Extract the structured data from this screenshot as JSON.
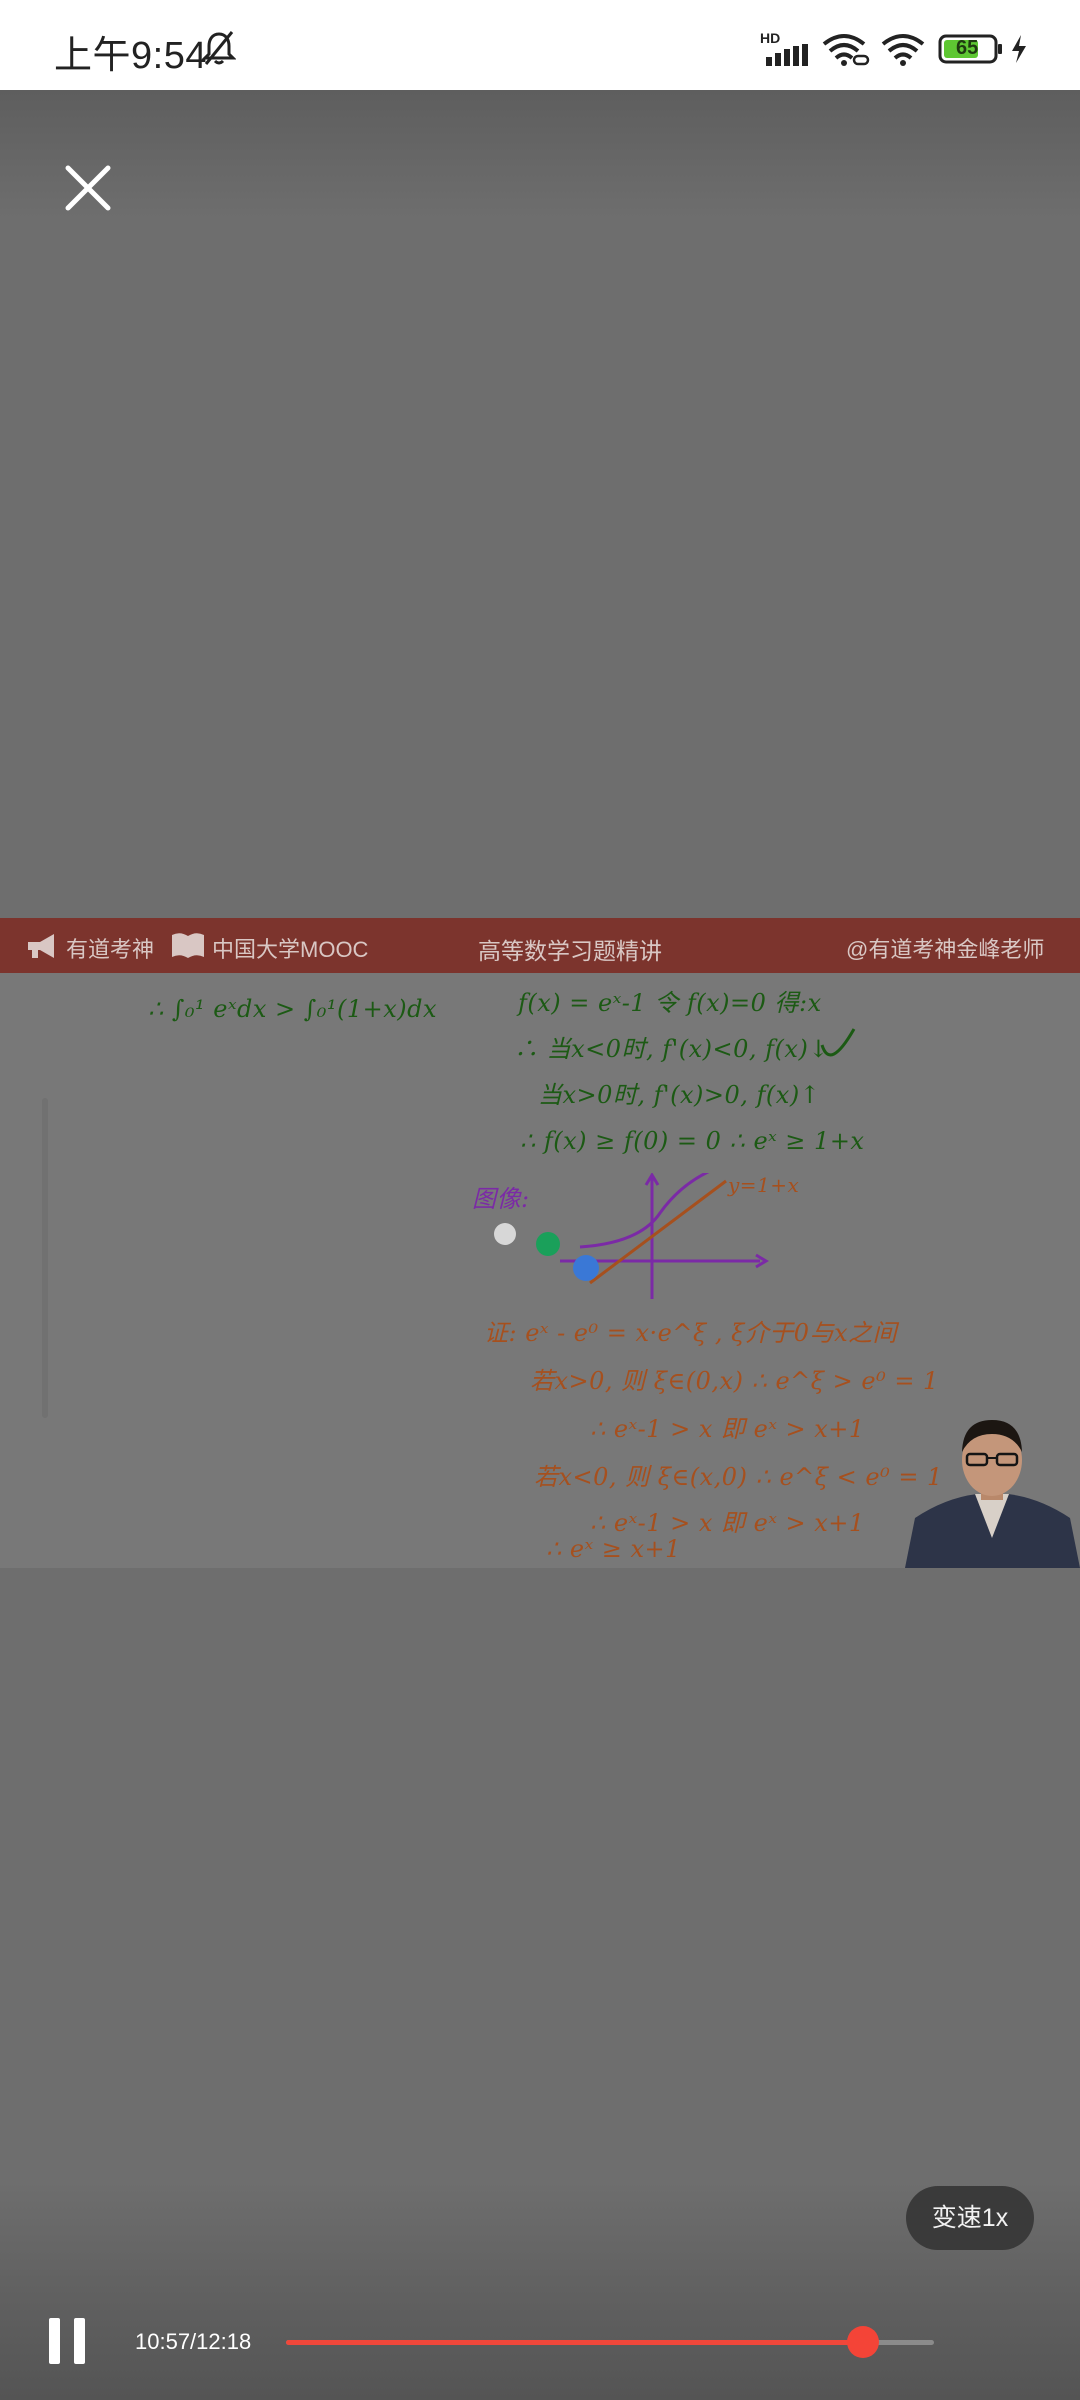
{
  "status_bar": {
    "time": "上午9:54",
    "battery_percent": "65",
    "signal_badge": "HD",
    "icons": [
      "bell-off-icon",
      "cellular-signal-icon",
      "wifi-link-icon",
      "wifi-icon",
      "battery-icon",
      "charging-icon"
    ]
  },
  "player": {
    "close_icon": "close-icon",
    "video": {
      "banner": {
        "brand_1": "有道考神",
        "brand_2": "中国大学MOOC",
        "course_title": "高等数学习题精讲",
        "teacher_handle": "@有道考神金峰老师"
      },
      "board": {
        "left_line": "∴ ∫₀¹ eˣdx > ∫₀¹(1+x)dx",
        "lines_green": [
          "f(x) = eˣ-1  令 f(x)=0 得:x",
          "∴ 当x<0时, f'(x)<0, f(x)↓",
          "当x>0时, f'(x)>0, f(x)↑",
          "∴ f(x) ≥ f(0) = 0   ∴ eˣ ≥ 1+x"
        ],
        "graph_label": "图像:",
        "curve_label": "y=1+x",
        "lines_orange": [
          "证:  eˣ - e⁰ = x·e^ξ ,  ξ介于0与x之间",
          "若x>0, 则 ξ∈(0,x)  ∴ e^ξ > e⁰ = 1",
          "∴ eˣ-1 > x  即  eˣ > x+1",
          "若x<0, 则 ξ∈(x,0)  ∴ e^ξ < e⁰ = 1",
          "∴ eˣ-1 > x  即  eˣ > x+1",
          "∴ eˣ ≥ x+1"
        ],
        "pen_colors": [
          "#d7d7d7",
          "#1aa05a",
          "#3a78d6"
        ]
      }
    },
    "controls": {
      "speed_label": "变速1x",
      "pause_icon": "pause-icon",
      "time_display": "10:57/12:18",
      "progress": 0.891,
      "accent_color": "#f0473a"
    }
  }
}
